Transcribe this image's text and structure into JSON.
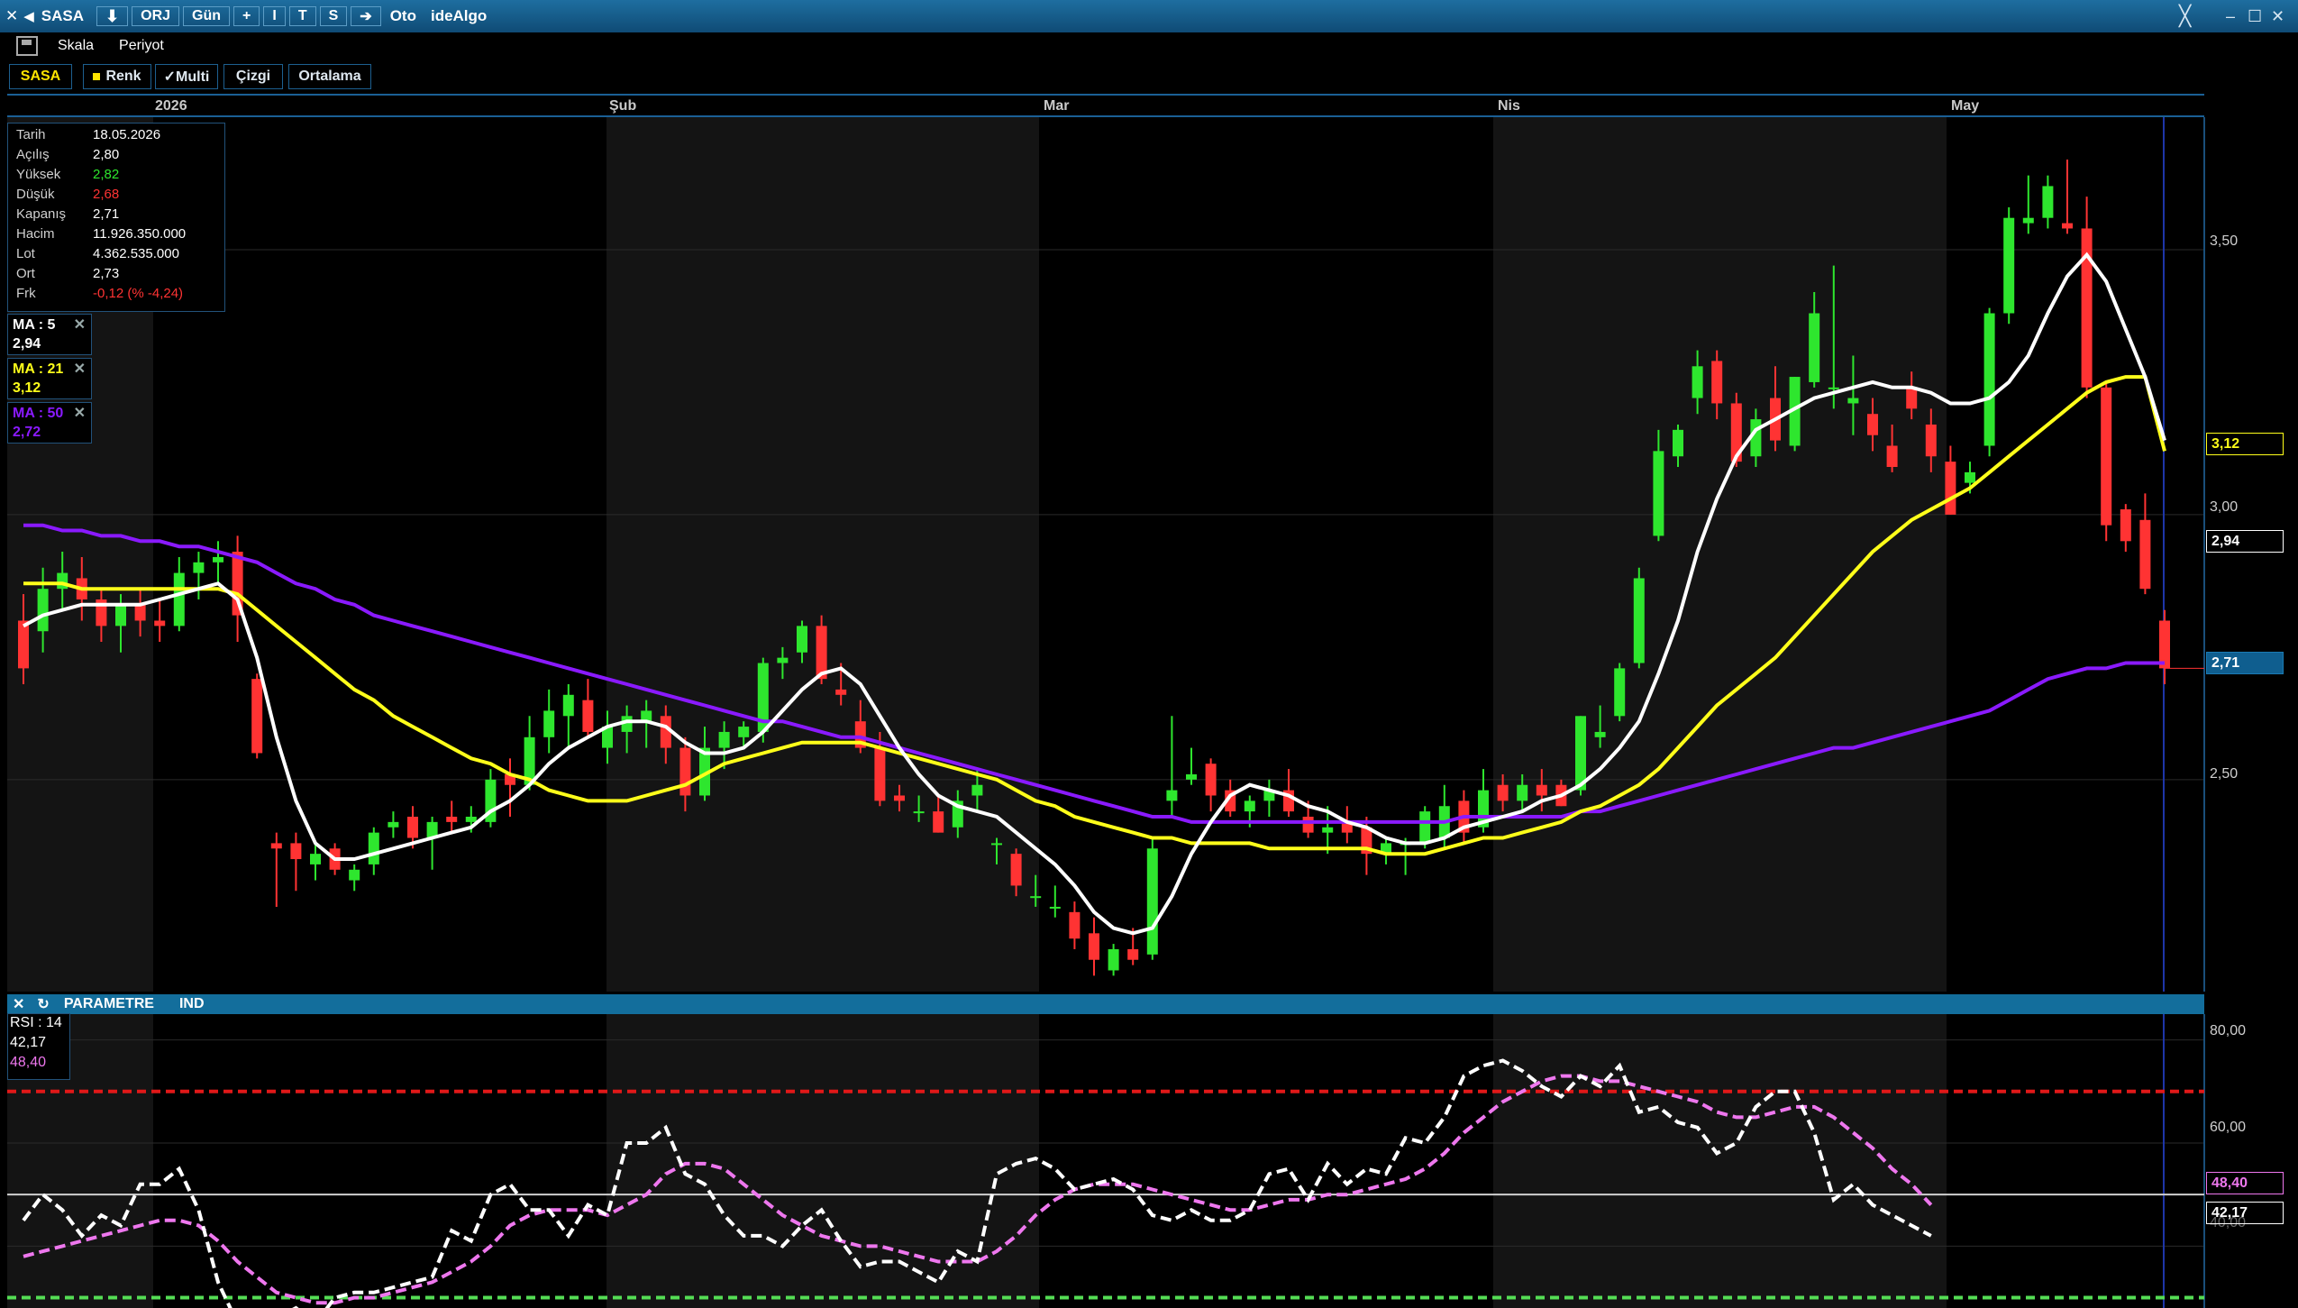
{
  "toolbar": {
    "symbol": "SASA",
    "orj_label": "ORJ",
    "period_label": "Gün",
    "plus_label": "+",
    "i_label": "I",
    "t_label": "T",
    "s_label": "S",
    "oto_label": "Oto",
    "brand_label": "ideAlgo"
  },
  "menu": {
    "skala": "Skala",
    "periyot": "Periyot"
  },
  "tabs": {
    "symbol": "SASA",
    "renk": "Renk",
    "multi": "✓Multi",
    "cizgi": "Çizgi",
    "ortalama": "Ortalama"
  },
  "months": [
    "2026",
    "Şub",
    "Mar",
    "Nis",
    "May"
  ],
  "info": {
    "tarih": {
      "k": "Tarih",
      "v": "18.05.2026"
    },
    "acilis": {
      "k": "Açılış",
      "v": "2,80"
    },
    "yuksek": {
      "k": "Yüksek",
      "v": "2,82"
    },
    "dusuk": {
      "k": "Düşük",
      "v": "2,68"
    },
    "kapanis": {
      "k": "Kapanış",
      "v": "2,71"
    },
    "hacim": {
      "k": "Hacim",
      "v": "11.926.350.000"
    },
    "lot": {
      "k": "Lot",
      "v": "4.362.535.000"
    },
    "ort": {
      "k": "Ort",
      "v": "2,73"
    },
    "frk": {
      "k": "Frk",
      "v": "-0,12 (% -4,24)"
    }
  },
  "ma5": {
    "label": "MA : 5",
    "value": "2,94"
  },
  "ma21": {
    "label": "MA : 21",
    "value": "3,12"
  },
  "ma50": {
    "label": "MA : 50",
    "value": "2,72"
  },
  "price_axis": [
    "3,50",
    "3,00",
    "2,50"
  ],
  "price_tags": {
    "ma21": "3,12",
    "ma5": "2,94",
    "close": "2,71"
  },
  "indicator_bar": {
    "close": "✕",
    "refresh": "↻",
    "parametre": "PARAMETRE",
    "ind": "IND"
  },
  "rsi": {
    "label": "RSI : 14",
    "value": "42,17",
    "signal": "48,40"
  },
  "rsi_axis": [
    "80,00",
    "60,00",
    "40,00"
  ],
  "rsi_tags": {
    "signal": "48,40",
    "value": "42,17"
  },
  "colors": {
    "up": "#2ee62e",
    "down": "#ff3333",
    "ma5": "#ffffff",
    "ma21": "#ffff1a",
    "ma50": "#8a1aff",
    "rsi": "#ffffff",
    "rsi_signal": "#ee77ee",
    "overbought": "#e01818",
    "oversold": "#55dd55"
  },
  "chart_data": {
    "type": "candlestick",
    "ohlc": [
      [
        2.8,
        2.85,
        2.68,
        2.71
      ],
      [
        2.78,
        2.9,
        2.74,
        2.86
      ],
      [
        2.86,
        2.93,
        2.82,
        2.89
      ],
      [
        2.88,
        2.92,
        2.8,
        2.84
      ],
      [
        2.84,
        2.86,
        2.76,
        2.79
      ],
      [
        2.79,
        2.85,
        2.74,
        2.83
      ],
      [
        2.83,
        2.86,
        2.77,
        2.8
      ],
      [
        2.8,
        2.84,
        2.76,
        2.79
      ],
      [
        2.79,
        2.92,
        2.78,
        2.89
      ],
      [
        2.89,
        2.93,
        2.84,
        2.91
      ],
      [
        2.91,
        2.95,
        2.87,
        2.92
      ],
      [
        2.93,
        2.96,
        2.76,
        2.81
      ],
      [
        2.69,
        2.7,
        2.54,
        2.55
      ],
      [
        2.38,
        2.4,
        2.26,
        2.37
      ],
      [
        2.38,
        2.4,
        2.29,
        2.35
      ],
      [
        2.34,
        2.38,
        2.31,
        2.36
      ],
      [
        2.37,
        2.38,
        2.32,
        2.33
      ],
      [
        2.31,
        2.34,
        2.29,
        2.33
      ],
      [
        2.34,
        2.41,
        2.32,
        2.4
      ],
      [
        2.41,
        2.44,
        2.39,
        2.42
      ],
      [
        2.43,
        2.45,
        2.37,
        2.39
      ],
      [
        2.39,
        2.43,
        2.33,
        2.42
      ],
      [
        2.43,
        2.46,
        2.4,
        2.42
      ],
      [
        2.42,
        2.45,
        2.4,
        2.43
      ],
      [
        2.42,
        2.52,
        2.41,
        2.5
      ],
      [
        2.51,
        2.54,
        2.43,
        2.49
      ],
      [
        2.49,
        2.62,
        2.48,
        2.58
      ],
      [
        2.58,
        2.67,
        2.55,
        2.63
      ],
      [
        2.62,
        2.68,
        2.56,
        2.66
      ],
      [
        2.65,
        2.69,
        2.58,
        2.59
      ],
      [
        2.56,
        2.63,
        2.53,
        2.6
      ],
      [
        2.59,
        2.64,
        2.55,
        2.62
      ],
      [
        2.61,
        2.65,
        2.56,
        2.63
      ],
      [
        2.62,
        2.64,
        2.53,
        2.56
      ],
      [
        2.56,
        2.58,
        2.44,
        2.47
      ],
      [
        2.47,
        2.6,
        2.46,
        2.56
      ],
      [
        2.56,
        2.61,
        2.52,
        2.59
      ],
      [
        2.58,
        2.61,
        2.56,
        2.6
      ],
      [
        2.59,
        2.73,
        2.57,
        2.72
      ],
      [
        2.72,
        2.75,
        2.69,
        2.73
      ],
      [
        2.74,
        2.8,
        2.72,
        2.79
      ],
      [
        2.79,
        2.81,
        2.68,
        2.69
      ],
      [
        2.67,
        2.72,
        2.64,
        2.66
      ],
      [
        2.61,
        2.65,
        2.55,
        2.56
      ],
      [
        2.56,
        2.59,
        2.45,
        2.46
      ],
      [
        2.47,
        2.49,
        2.44,
        2.46
      ],
      [
        2.44,
        2.47,
        2.42,
        2.44
      ],
      [
        2.44,
        2.47,
        2.4,
        2.4
      ],
      [
        2.41,
        2.48,
        2.39,
        2.46
      ],
      [
        2.47,
        2.52,
        2.44,
        2.49
      ],
      [
        2.38,
        2.39,
        2.34,
        2.38
      ],
      [
        2.36,
        2.37,
        2.28,
        2.3
      ],
      [
        2.28,
        2.32,
        2.26,
        2.28
      ],
      [
        2.26,
        2.3,
        2.24,
        2.26
      ],
      [
        2.25,
        2.27,
        2.18,
        2.2
      ],
      [
        2.21,
        2.24,
        2.13,
        2.16
      ],
      [
        2.14,
        2.19,
        2.13,
        2.18
      ],
      [
        2.18,
        2.22,
        2.15,
        2.16
      ],
      [
        2.17,
        2.39,
        2.16,
        2.37
      ],
      [
        2.46,
        2.62,
        2.43,
        2.48
      ],
      [
        2.5,
        2.56,
        2.49,
        2.51
      ],
      [
        2.53,
        2.54,
        2.44,
        2.47
      ],
      [
        2.48,
        2.5,
        2.43,
        2.44
      ],
      [
        2.44,
        2.47,
        2.41,
        2.46
      ],
      [
        2.46,
        2.5,
        2.43,
        2.48
      ],
      [
        2.48,
        2.52,
        2.43,
        2.44
      ],
      [
        2.43,
        2.46,
        2.39,
        2.4
      ],
      [
        2.4,
        2.45,
        2.36,
        2.41
      ],
      [
        2.42,
        2.45,
        2.38,
        2.4
      ],
      [
        2.41,
        2.43,
        2.32,
        2.36
      ],
      [
        2.36,
        2.39,
        2.34,
        2.38
      ],
      [
        2.38,
        2.39,
        2.32,
        2.38
      ],
      [
        2.38,
        2.45,
        2.37,
        2.44
      ],
      [
        2.39,
        2.49,
        2.37,
        2.45
      ],
      [
        2.46,
        2.48,
        2.38,
        2.4
      ],
      [
        2.41,
        2.52,
        2.4,
        2.48
      ],
      [
        2.49,
        2.51,
        2.44,
        2.46
      ],
      [
        2.46,
        2.51,
        2.44,
        2.49
      ],
      [
        2.49,
        2.52,
        2.44,
        2.47
      ],
      [
        2.49,
        2.5,
        2.45,
        2.45
      ],
      [
        2.48,
        2.62,
        2.47,
        2.62
      ],
      [
        2.58,
        2.64,
        2.56,
        2.59
      ],
      [
        2.62,
        2.72,
        2.61,
        2.71
      ],
      [
        2.72,
        2.9,
        2.71,
        2.88
      ],
      [
        2.96,
        3.16,
        2.95,
        3.12
      ],
      [
        3.11,
        3.17,
        3.09,
        3.16
      ],
      [
        3.22,
        3.31,
        3.19,
        3.28
      ],
      [
        3.29,
        3.31,
        3.18,
        3.21
      ],
      [
        3.21,
        3.23,
        3.09,
        3.1
      ],
      [
        3.11,
        3.2,
        3.09,
        3.18
      ],
      [
        3.22,
        3.28,
        3.12,
        3.14
      ],
      [
        3.13,
        3.26,
        3.12,
        3.26
      ],
      [
        3.25,
        3.42,
        3.24,
        3.38
      ],
      [
        3.24,
        3.47,
        3.2,
        3.24
      ],
      [
        3.21,
        3.3,
        3.15,
        3.22
      ],
      [
        3.19,
        3.22,
        3.12,
        3.15
      ],
      [
        3.13,
        3.17,
        3.08,
        3.09
      ],
      [
        3.24,
        3.27,
        3.18,
        3.2
      ],
      [
        3.17,
        3.2,
        3.08,
        3.11
      ],
      [
        3.1,
        3.13,
        3.0,
        3.0
      ],
      [
        3.06,
        3.1,
        3.04,
        3.08
      ],
      [
        3.13,
        3.39,
        3.11,
        3.38
      ],
      [
        3.38,
        3.58,
        3.36,
        3.56
      ],
      [
        3.55,
        3.64,
        3.53,
        3.56
      ],
      [
        3.56,
        3.64,
        3.54,
        3.62
      ],
      [
        3.55,
        3.67,
        3.53,
        3.54
      ],
      [
        3.54,
        3.6,
        3.22,
        3.24
      ],
      [
        3.24,
        3.25,
        2.95,
        2.98
      ],
      [
        3.01,
        3.02,
        2.93,
        2.95
      ],
      [
        2.99,
        3.04,
        2.85,
        2.86
      ],
      [
        2.8,
        2.82,
        2.68,
        2.71
      ]
    ],
    "ma5": [
      2.79,
      2.81,
      2.82,
      2.83,
      2.83,
      2.83,
      2.83,
      2.84,
      2.85,
      2.86,
      2.87,
      2.84,
      2.73,
      2.58,
      2.46,
      2.38,
      2.35,
      2.35,
      2.36,
      2.37,
      2.38,
      2.39,
      2.4,
      2.41,
      2.44,
      2.46,
      2.49,
      2.53,
      2.56,
      2.58,
      2.6,
      2.61,
      2.61,
      2.6,
      2.57,
      2.55,
      2.55,
      2.56,
      2.59,
      2.63,
      2.67,
      2.7,
      2.71,
      2.68,
      2.62,
      2.56,
      2.51,
      2.47,
      2.45,
      2.44,
      2.43,
      2.4,
      2.37,
      2.34,
      2.3,
      2.25,
      2.22,
      2.21,
      2.22,
      2.28,
      2.36,
      2.42,
      2.47,
      2.49,
      2.48,
      2.47,
      2.45,
      2.44,
      2.42,
      2.41,
      2.39,
      2.38,
      2.38,
      2.39,
      2.41,
      2.42,
      2.43,
      2.44,
      2.46,
      2.47,
      2.49,
      2.52,
      2.56,
      2.61,
      2.7,
      2.8,
      2.93,
      3.03,
      3.11,
      3.16,
      3.18,
      3.2,
      3.22,
      3.23,
      3.24,
      3.25,
      3.24,
      3.24,
      3.23,
      3.21,
      3.21,
      3.22,
      3.25,
      3.3,
      3.38,
      3.45,
      3.49,
      3.44,
      3.35,
      3.26,
      3.14
    ],
    "ma21": [
      2.87,
      2.87,
      2.87,
      2.86,
      2.86,
      2.86,
      2.86,
      2.86,
      2.86,
      2.86,
      2.86,
      2.85,
      2.82,
      2.79,
      2.76,
      2.73,
      2.7,
      2.67,
      2.65,
      2.62,
      2.6,
      2.58,
      2.56,
      2.54,
      2.53,
      2.51,
      2.5,
      2.48,
      2.47,
      2.46,
      2.46,
      2.46,
      2.47,
      2.48,
      2.49,
      2.51,
      2.53,
      2.54,
      2.55,
      2.56,
      2.57,
      2.57,
      2.57,
      2.57,
      2.56,
      2.55,
      2.54,
      2.53,
      2.52,
      2.51,
      2.5,
      2.48,
      2.46,
      2.45,
      2.43,
      2.42,
      2.41,
      2.4,
      2.39,
      2.39,
      2.38,
      2.38,
      2.38,
      2.38,
      2.37,
      2.37,
      2.37,
      2.37,
      2.37,
      2.37,
      2.36,
      2.36,
      2.36,
      2.37,
      2.38,
      2.39,
      2.39,
      2.4,
      2.41,
      2.42,
      2.44,
      2.45,
      2.47,
      2.49,
      2.52,
      2.56,
      2.6,
      2.64,
      2.67,
      2.7,
      2.73,
      2.77,
      2.81,
      2.85,
      2.89,
      2.93,
      2.96,
      2.99,
      3.01,
      3.03,
      3.05,
      3.08,
      3.11,
      3.14,
      3.17,
      3.2,
      3.23,
      3.25,
      3.26,
      3.26,
      3.12
    ],
    "ma50": [
      2.98,
      2.98,
      2.97,
      2.97,
      2.96,
      2.96,
      2.95,
      2.95,
      2.94,
      2.94,
      2.93,
      2.92,
      2.91,
      2.89,
      2.87,
      2.86,
      2.84,
      2.83,
      2.81,
      2.8,
      2.79,
      2.78,
      2.77,
      2.76,
      2.75,
      2.74,
      2.73,
      2.72,
      2.71,
      2.7,
      2.69,
      2.68,
      2.67,
      2.66,
      2.65,
      2.64,
      2.63,
      2.62,
      2.61,
      2.61,
      2.6,
      2.59,
      2.58,
      2.58,
      2.57,
      2.56,
      2.55,
      2.54,
      2.53,
      2.52,
      2.51,
      2.5,
      2.49,
      2.48,
      2.47,
      2.46,
      2.45,
      2.44,
      2.43,
      2.43,
      2.42,
      2.42,
      2.42,
      2.42,
      2.42,
      2.42,
      2.42,
      2.42,
      2.42,
      2.42,
      2.42,
      2.42,
      2.42,
      2.42,
      2.43,
      2.43,
      2.43,
      2.43,
      2.43,
      2.43,
      2.44,
      2.44,
      2.45,
      2.46,
      2.47,
      2.48,
      2.49,
      2.5,
      2.51,
      2.52,
      2.53,
      2.54,
      2.55,
      2.56,
      2.56,
      2.57,
      2.58,
      2.59,
      2.6,
      2.61,
      2.62,
      2.63,
      2.65,
      2.67,
      2.69,
      2.7,
      2.71,
      2.71,
      2.72,
      2.72,
      2.72
    ],
    "rsi": [
      45,
      50,
      47,
      42,
      46,
      44,
      52,
      52,
      55,
      47,
      33,
      25,
      24,
      26,
      28,
      25,
      30,
      31,
      31,
      32,
      33,
      34,
      43,
      41,
      50,
      52,
      47,
      47,
      42,
      48,
      46,
      60,
      60,
      63,
      54,
      52,
      46,
      42,
      42,
      40,
      44,
      47,
      41,
      36,
      37,
      37,
      35,
      33,
      39,
      37,
      54,
      56,
      57,
      55,
      51,
      52,
      53,
      51,
      46,
      45,
      47,
      45,
      45,
      47,
      54,
      55,
      49,
      56,
      52,
      55,
      54,
      61,
      60,
      65,
      73,
      75,
      76,
      74,
      71,
      69,
      73,
      71,
      75,
      66,
      67,
      64,
      63,
      58,
      60,
      67,
      70,
      70,
      62,
      49,
      52,
      48,
      46,
      44,
      42
    ],
    "rsi_signal": [
      38,
      39,
      40,
      41,
      42,
      43,
      44,
      45,
      45,
      44,
      41,
      37,
      34,
      31,
      30,
      29,
      29,
      30,
      30,
      31,
      32,
      33,
      35,
      37,
      40,
      44,
      46,
      47,
      47,
      47,
      46,
      48,
      50,
      54,
      56,
      56,
      55,
      52,
      49,
      46,
      44,
      42,
      41,
      40,
      40,
      39,
      38,
      37,
      37,
      37,
      39,
      42,
      46,
      49,
      51,
      52,
      52,
      52,
      51,
      50,
      49,
      48,
      47,
      47,
      48,
      49,
      49,
      50,
      50,
      51,
      52,
      53,
      55,
      58,
      62,
      65,
      68,
      70,
      72,
      73,
      73,
      72,
      72,
      71,
      70,
      69,
      68,
      66,
      65,
      65,
      66,
      67,
      67,
      65,
      62,
      59,
      55,
      52,
      48
    ],
    "price_ylim": [
      2.1,
      3.75
    ],
    "rsi_ylim": [
      28,
      85
    ],
    "rsi_levels": [
      70,
      30
    ]
  }
}
